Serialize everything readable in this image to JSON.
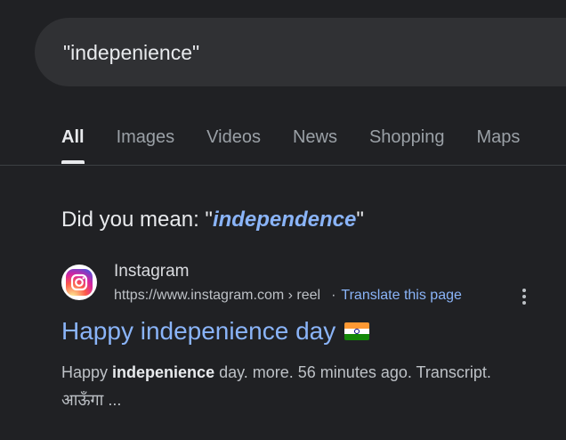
{
  "search": {
    "query": "\"indepenience\""
  },
  "tabs": [
    {
      "label": "All",
      "active": true
    },
    {
      "label": "Images",
      "active": false
    },
    {
      "label": "Videos",
      "active": false
    },
    {
      "label": "News",
      "active": false
    },
    {
      "label": "Shopping",
      "active": false
    },
    {
      "label": "Maps",
      "active": false
    }
  ],
  "did_you_mean": {
    "prefix": "Did you mean: \"",
    "suggestion": "independence",
    "suffix": "\""
  },
  "result": {
    "source_name": "Instagram",
    "url": "https://www.instagram.com › reel",
    "separator": "·",
    "translate_label": "Translate this page",
    "title": "Happy indepenience day",
    "flag_icon": "india-flag-icon",
    "snippet_before": "Happy ",
    "snippet_bold": "indepenience",
    "snippet_after": " day. more. 56 minutes ago. Transcript.",
    "snippet_line2": "आऊँगा ..."
  },
  "colors": {
    "background": "#202124",
    "link": "#8ab4f8",
    "text": "#e8eaed",
    "muted": "#9aa0a6"
  }
}
